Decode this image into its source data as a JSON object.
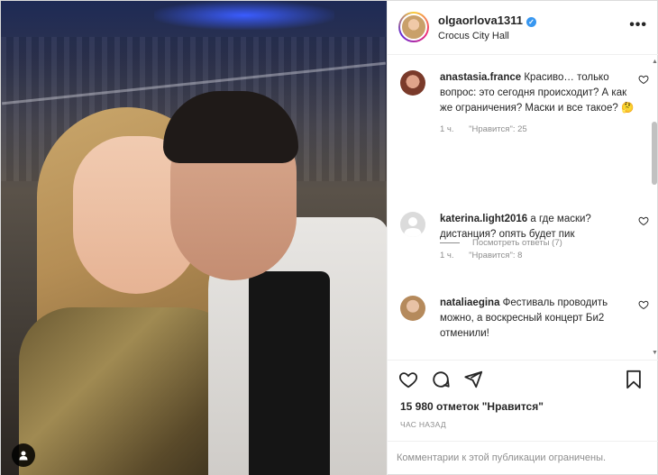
{
  "header": {
    "username": "olgaorlova1311",
    "location": "Crocus City Hall",
    "more_label": "•••"
  },
  "comments": [
    {
      "user": "anastasia.france",
      "text": "Красиво… только вопрос: это сегодня происходит? А как же ограничения? Маски и все такое? 🤔",
      "time": "1 ч.",
      "likes": "\"Нравится\": 25"
    },
    {
      "user": "katerina.light2016",
      "text": "а где маски? дистанция? опять будет пик",
      "time": "1 ч.",
      "likes": "\"Нравится\": 8"
    },
    {
      "user": "nataliaegina",
      "text": "Фестиваль проводить можно, а воскресный концерт Би2 отменили!",
      "time": "",
      "likes": ""
    }
  ],
  "replies_label": "Посмотреть ответы (7)",
  "likes_count": "15 980 отметок \"Нравится\"",
  "timestamp": "час назад",
  "comments_disabled": "Комментарии к этой публикации ограничены.",
  "colors": {
    "verified": "#3897f0",
    "muted_text": "#8e8e8e",
    "border": "#efefef"
  },
  "icons": [
    "more-icon",
    "verified-icon",
    "heart-icon",
    "comment-icon",
    "share-icon",
    "bookmark-icon",
    "user-tag-icon"
  ]
}
